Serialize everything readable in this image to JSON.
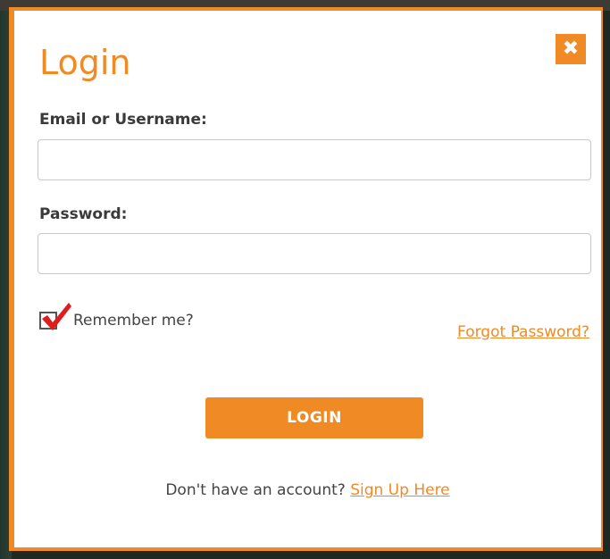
{
  "dialog": {
    "title": "Login",
    "close_icon": "close-icon",
    "close_glyph": "✖"
  },
  "form": {
    "email_label": "Email or Username:",
    "email_value": "",
    "email_placeholder": "",
    "password_label": "Password:",
    "password_value": "",
    "password_placeholder": "",
    "remember_label": "Remember me?",
    "remember_checked": true,
    "forgot_link": "Forgot Password?",
    "login_button": "LOGIN"
  },
  "signup": {
    "prompt": "Don't have an account?",
    "link": "Sign Up Here"
  },
  "colors": {
    "accent": "#f08a24",
    "check_red": "#e21b1b",
    "text": "#444444"
  }
}
